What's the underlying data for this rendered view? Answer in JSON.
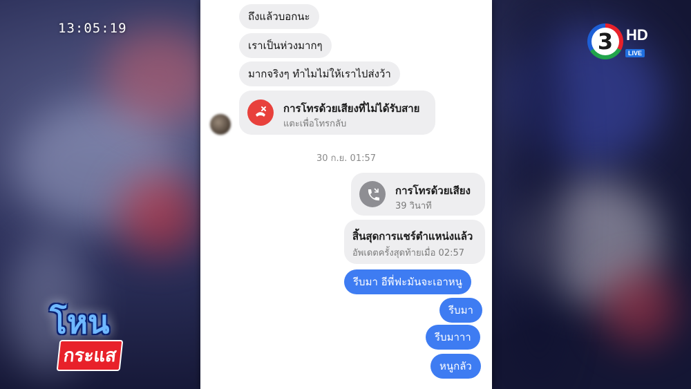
{
  "broadcast": {
    "clock": "13:05:19",
    "channel_number": "3",
    "channel_hd": "HD",
    "channel_live": "LIVE",
    "show_title_top": "โหน",
    "show_title_bottom": "กระแส"
  },
  "chat": {
    "incoming_messages": [
      "ถึงแล้วบอกนะ",
      "เราเป็นห่วงมากๆ",
      "มากจริงๆ ทำไมไม่ให้เราไปส่งว้า"
    ],
    "missed_call": {
      "title": "การโทรด้วยเสียงที่ไม่ได้รับสาย",
      "subtitle": "แตะเพื่อโทรกลับ",
      "icon": "missed-call-icon",
      "icon_color": "#e8413c"
    },
    "timestamp": "30 ก.ย. 01:57",
    "voice_call": {
      "title": "การโทรด้วยเสียง",
      "subtitle": "39 วินาที",
      "icon": "phone-icon",
      "icon_color": "#8e8e93"
    },
    "location_share": {
      "title": "สิ้นสุดการแชร์ตำแหน่งแล้ว",
      "subtitle": "อัพเดตครั้งสุดท้ายเมื่อ 02:57"
    },
    "outgoing_messages": [
      "รีบมา อีพี่ฟะมันจะเอาหนู",
      "รีบมา",
      "รีบมาาา",
      "หนูกลัว"
    ],
    "outgoing_color": "#3e7cf2"
  }
}
